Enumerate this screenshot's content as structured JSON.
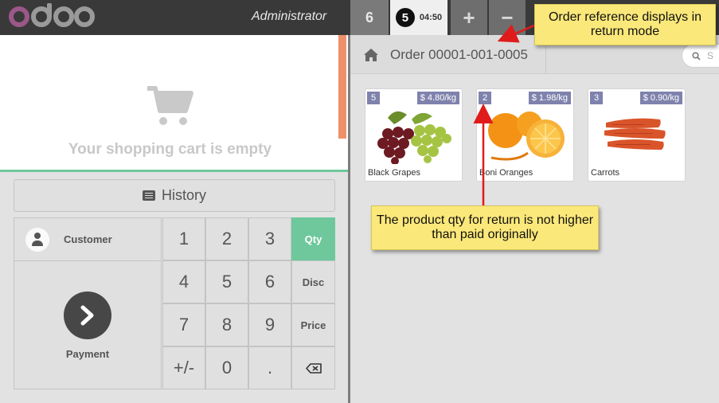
{
  "header": {
    "brand": "odoo",
    "user_name": "Administrator",
    "order_tabs": [
      {
        "label": "6"
      },
      {
        "label": "5",
        "time": "04:50"
      }
    ],
    "add_label": "+",
    "remove_label": "−"
  },
  "cart": {
    "empty_message": "Your shopping cart is empty"
  },
  "actions": {
    "history_label": "History",
    "customer_label": "Customer",
    "payment_label": "Payment"
  },
  "numpad": {
    "keys": [
      "1",
      "2",
      "3",
      "Qty",
      "4",
      "5",
      "6",
      "Disc",
      "7",
      "8",
      "9",
      "Price",
      "+/-",
      "0",
      "."
    ],
    "active_mode": "Qty"
  },
  "products_header": {
    "order_reference": "Order 00001-001-0005",
    "search_placeholder": "S"
  },
  "products": [
    {
      "name": "Black Grapes",
      "qty": "5",
      "price": "$ 4.80/kg"
    },
    {
      "name": "Boni Oranges",
      "qty": "2",
      "price": "$ 1.98/kg"
    },
    {
      "name": "Carrots",
      "qty": "3",
      "price": "$ 0.90/kg"
    }
  ],
  "annotations": {
    "order_ref_note": "Order reference displays in return mode",
    "qty_note": "The product qty for return is not higher than paid originally"
  },
  "colors": {
    "accent_green": "#6ec89b",
    "badge_purple": "#7f82ac",
    "callout_yellow": "#fbe87a",
    "brand_purple": "#875a7b"
  }
}
